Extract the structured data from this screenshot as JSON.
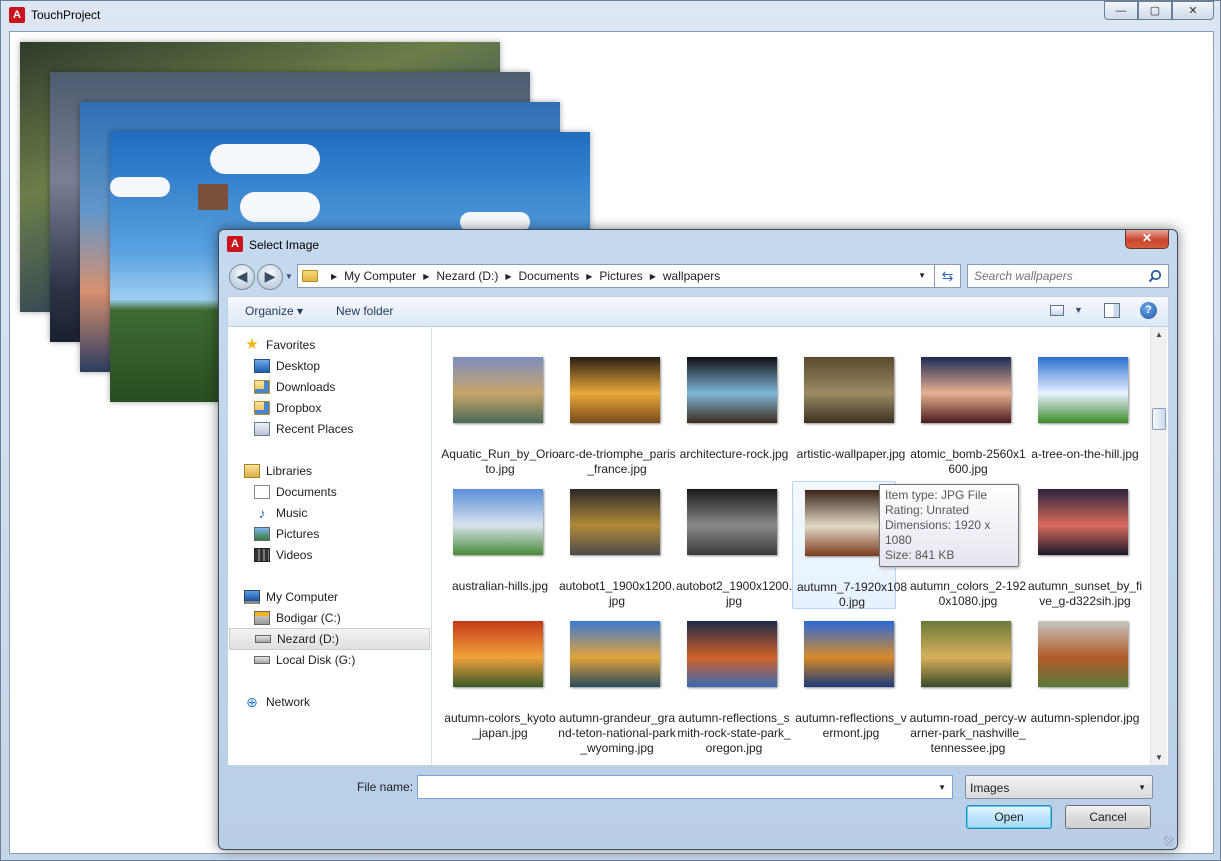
{
  "main_window": {
    "title": "TouchProject",
    "app_icon_glyph": "A",
    "controls": {
      "minimize": "—",
      "maximize": "▢",
      "close": "✕"
    }
  },
  "dialog": {
    "title": "Select Image",
    "close_glyph": "✕",
    "nav": {
      "back": "◀",
      "forward": "▶",
      "dropdown": "▼"
    },
    "breadcrumb": [
      "My Computer",
      "Nezard (D:)",
      "Documents",
      "Pictures",
      "wallpapers"
    ],
    "breadcrumb_sep": "▶",
    "address_dropdown": "▼",
    "refresh_glyph": "⇆",
    "search_placeholder": "Search wallpapers",
    "toolbar": {
      "organize": "Organize ▾",
      "new_folder": "New folder",
      "view_caret": "▼",
      "help": "?"
    },
    "nav_pane": {
      "favorites_header": "Favorites",
      "favorites": [
        "Desktop",
        "Downloads",
        "Dropbox",
        "Recent Places"
      ],
      "libraries_header": "Libraries",
      "libraries": [
        "Documents",
        "Music",
        "Pictures",
        "Videos"
      ],
      "computer_header": "My Computer",
      "drives": [
        "Bodigar (C:)",
        "Nezard (D:)",
        "Local Disk (G:)"
      ],
      "network": "Network",
      "selected": "Nezard (D:)"
    },
    "files": [
      {
        "name": "Aquatic_Run_by_Orioto.jpg",
        "colors": [
          "#7e8fbf",
          "#c7a56a",
          "#4a6a56"
        ]
      },
      {
        "name": "arc-de-triomphe_paris_france.jpg",
        "colors": [
          "#2a1e12",
          "#e8a93c",
          "#7b4a1a"
        ]
      },
      {
        "name": "architecture-rock.jpg",
        "colors": [
          "#101010",
          "#7fb6d8",
          "#3d2b1d"
        ]
      },
      {
        "name": "artistic-wallpaper.jpg",
        "colors": [
          "#5a4a2e",
          "#9b8a64",
          "#3c3220"
        ]
      },
      {
        "name": "atomic_bomb-2560x1600.jpg",
        "colors": [
          "#1b2a55",
          "#e8b090",
          "#4a1d1d"
        ]
      },
      {
        "name": "a-tree-on-the-hill.jpg",
        "colors": [
          "#2b6fd0",
          "#e7f1ff",
          "#3f8a2a"
        ]
      },
      {
        "name": "australian-hills.jpg",
        "colors": [
          "#5a8fd8",
          "#d8e3ec",
          "#4b8a3b"
        ]
      },
      {
        "name": "autobot1_1900x1200.jpg",
        "colors": [
          "#2a2a2a",
          "#b08a3a",
          "#4a4a4a"
        ]
      },
      {
        "name": "autobot2_1900x1200.jpg",
        "colors": [
          "#1a1a1a",
          "#8a8a8a",
          "#3a3a3a"
        ]
      },
      {
        "name": "autumn_7-1920x1080.jpg",
        "colors": [
          "#3a2418",
          "#e2d9c5",
          "#7a3c20"
        ]
      },
      {
        "name": "autumn_colors_2-1920x1080.jpg",
        "colors": [
          "#5a3a1a",
          "#d08a2a",
          "#2a4a1a"
        ]
      },
      {
        "name": "autumn_sunset_by_five_g-d322sih.jpg",
        "colors": [
          "#2a2440",
          "#d86a5a",
          "#1a1a2a"
        ]
      },
      {
        "name": "autumn-colors_kyoto_japan.jpg",
        "colors": [
          "#c23a1a",
          "#f2a23a",
          "#3a5a2a"
        ]
      },
      {
        "name": "autumn-grandeur_grand-teton-national-park_wyoming.jpg",
        "colors": [
          "#3a7ad0",
          "#e0a33a",
          "#2a4a5a"
        ]
      },
      {
        "name": "autumn-reflections_smith-rock-state-park_oregon.jpg",
        "colors": [
          "#1a2a4a",
          "#d0602a",
          "#3a6ab0"
        ]
      },
      {
        "name": "autumn-reflections_vermont.jpg",
        "colors": [
          "#2a6ad8",
          "#d88a2a",
          "#1a3a7a"
        ]
      },
      {
        "name": "autumn-road_percy-warner-park_nashville_tennessee.jpg",
        "colors": [
          "#6a7a3a",
          "#d8b05a",
          "#3a4a2a"
        ]
      },
      {
        "name": "autumn-splendor.jpg",
        "colors": [
          "#c8c8c0",
          "#b05a2a",
          "#5a7a3a"
        ]
      }
    ],
    "tooltip": {
      "item_type": "Item type: JPG File",
      "rating": "Rating: Unrated",
      "dimensions": "Dimensions: 1920 x 1080",
      "size": "Size: 841 KB"
    },
    "file_name_label": "File name:",
    "file_name_value": "",
    "file_type": "Images",
    "open_button": "Open",
    "cancel_button": "Cancel"
  }
}
